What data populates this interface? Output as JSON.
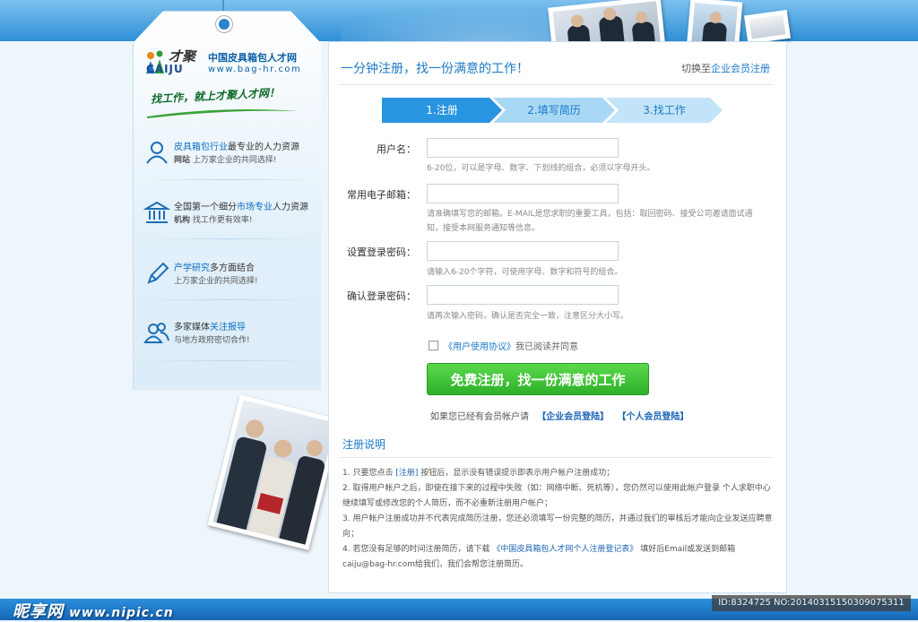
{
  "brand": {
    "name_short": "才聚",
    "name_en": "CAIJU",
    "site_name": "中国皮具箱包人才网",
    "url": "www.bag-hr.com",
    "slogan": "找工作，就上才聚人才网！"
  },
  "features": [
    {
      "icon": "person-icon",
      "line1_hl": "皮具箱包行业",
      "line1_rest": "最专业的人力资源",
      "line2_b": "网站",
      "line2_rest": " 上万家企业的共同选择!"
    },
    {
      "icon": "bank-icon",
      "line1_pre": "全国第一个细分",
      "line1_hl": "市场专业",
      "line1_rest": "人力资源",
      "line2_b": "机构",
      "line2_rest": " 找工作更有效率!"
    },
    {
      "icon": "pen-icon",
      "line1_hl": "产学研究",
      "line1_rest": "多方面结合",
      "line2_b": "",
      "line2_rest": "上万家企业的共同选择!"
    },
    {
      "icon": "users-icon",
      "line1_pre": "多家媒体",
      "line1_hl": "关注报导",
      "line1_rest": "",
      "line2_b": "",
      "line2_rest": "与地方政府密切合作!"
    }
  ],
  "header": {
    "headline": "一分钟注册，找一份满意的工作！",
    "switch_prefix": "切换至",
    "switch_link": "企业会员注册"
  },
  "steps": [
    "1.注册",
    "2.填写简历",
    "3.找工作"
  ],
  "form": {
    "username_label": "用户名：",
    "username_hint": "6-20位，可以是字母、数字、下划线的组合，必须以字母开头。",
    "email_label": "常用电子邮箱：",
    "email_hint": "请准确填写您的邮箱。E-MAIL是您求职的重要工具，包括：取回密码、接受公司邀请面试通知，接受本网服务通知等信息。",
    "password_label": "设置登录密码：",
    "password_hint": "请输入6-20个字符，可使用字母、数字和符号的组合。",
    "confirm_label": "确认登录密码：",
    "confirm_hint": "请再次输入密码，确认是否完全一致，注意区分大小写。",
    "agreement_link": "《用户使用协议》",
    "agreement_text": "我已阅读并同意",
    "submit_label": "免费注册，找一份满意的工作",
    "already_text": "如果您已经有会员帐户请",
    "enterprise_login": "【企业会员登陆】",
    "personal_login": "【个人会员登陆】"
  },
  "notes": {
    "title": "注册说明",
    "items": [
      {
        "pre": "1. 只要您点击 ",
        "hl": "[注册]",
        "post": " 按钮后，显示没有错误提示即表示用户帐户注册成功；"
      },
      {
        "pre": "2. 取得用户帐户之后，即使在接下来的过程中失败（如：网络中断、死机等），您仍然可以使用此帐户登录 个人求职中心 继续填写或修改您的个人简历，而不必重新注册用户帐户；",
        "hl": "",
        "post": ""
      },
      {
        "pre": "3. 用户帐户注册成功并不代表完成简历注册，您还必须填写一份完整的简历，并通过我们的审核后才能向企业发送应聘意向；",
        "hl": "",
        "post": ""
      },
      {
        "pre": "4. 若您没有足够的时间注册简历，请下载 ",
        "hl": "《中国皮具箱包人才网个人注册登记表》",
        "post": " 填好后Email或发送到邮箱 caiju@bag-hr.com给我们，我们会帮您注册简历。"
      }
    ]
  },
  "watermark": {
    "left_site": "昵享网",
    "left_url": "www.nipic.cn",
    "right_id": "ID:8324725 NO:20140315150309075311"
  },
  "colors": {
    "accent": "#1b7ac9",
    "submit_green": "#2eb029",
    "topbar": "#2e8fd6"
  }
}
